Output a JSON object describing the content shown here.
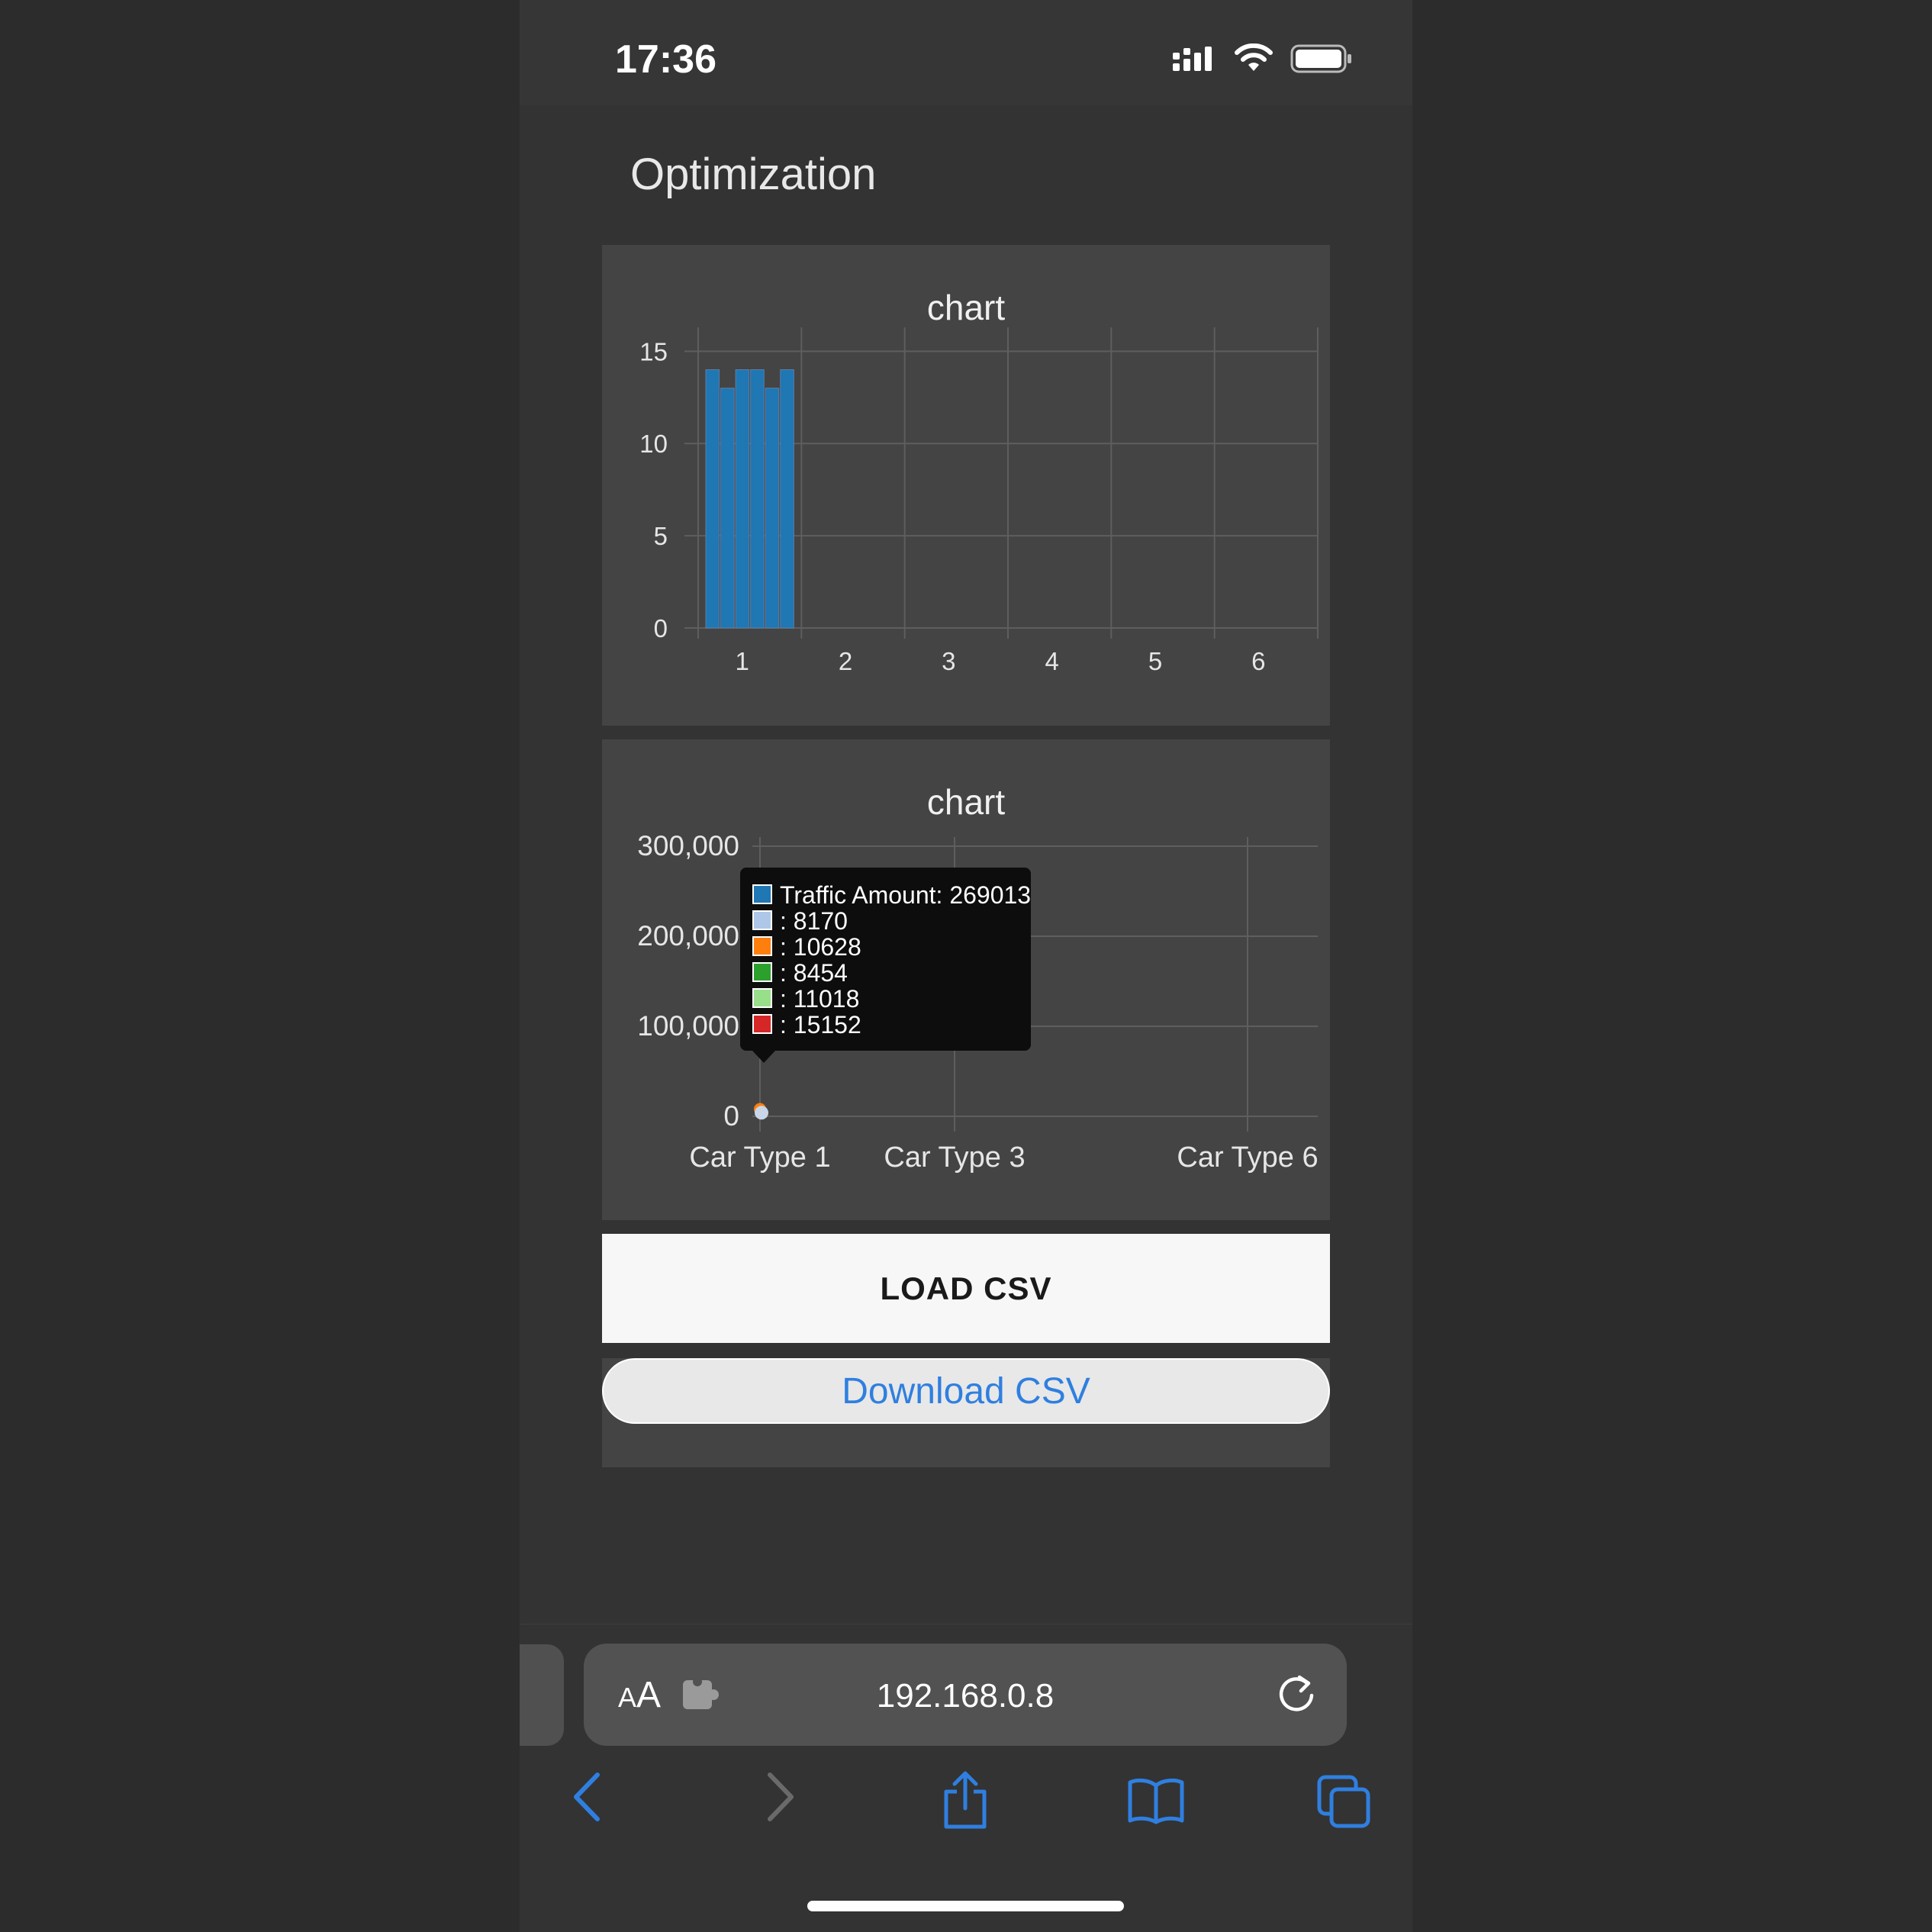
{
  "status_bar": {
    "time": "17:36"
  },
  "page": {
    "title": "Optimization"
  },
  "chart_data": [
    {
      "type": "bar",
      "title": "chart",
      "categories": [
        "1",
        "2",
        "3",
        "4",
        "5",
        "6"
      ],
      "series": [
        {
          "values": [
            14,
            0,
            0,
            0,
            0,
            0
          ]
        },
        {
          "values": [
            13,
            0,
            0,
            0,
            0,
            0
          ]
        },
        {
          "values": [
            14,
            0,
            0,
            0,
            0,
            0
          ]
        },
        {
          "values": [
            14,
            0,
            0,
            0,
            0,
            0
          ]
        },
        {
          "values": [
            13,
            0,
            0,
            0,
            0,
            0
          ]
        },
        {
          "values": [
            14,
            0,
            0,
            0,
            0,
            0
          ]
        }
      ],
      "yticks": [
        "0",
        "5",
        "10",
        "15"
      ],
      "ylim": [
        0,
        15.8
      ],
      "grid": true,
      "bar_color": "#1f77b4"
    },
    {
      "type": "bar",
      "title": "chart",
      "categories": [
        "Car Type 1",
        "Car Type 3",
        "Car Type 6"
      ],
      "yticks": [
        "0",
        "100,000",
        "200,000",
        "300,000"
      ],
      "ylim": [
        0,
        300000
      ],
      "grid": true,
      "tooltip": {
        "items": [
          {
            "label": "Traffic Amount: 269013",
            "color": "#1f77b4"
          },
          {
            "label": ": 8170",
            "color": "#aec7e8"
          },
          {
            "label": ": 10628",
            "color": "#ff7f0e"
          },
          {
            "label": ": 8454",
            "color": "#2ca02c"
          },
          {
            "label": ": 11018",
            "color": "#98df8a"
          },
          {
            "label": ": 15152",
            "color": "#d62728"
          }
        ]
      }
    }
  ],
  "buttons": {
    "load_csv": "LOAD CSV",
    "download_csv": "Download CSV"
  },
  "browser": {
    "aa_small": "A",
    "aa_big": "A",
    "url": "192.168.0.8"
  },
  "colors": {
    "accent": "#2f7fe0",
    "panel_bg": "#444444",
    "page_bg": "#333333"
  }
}
